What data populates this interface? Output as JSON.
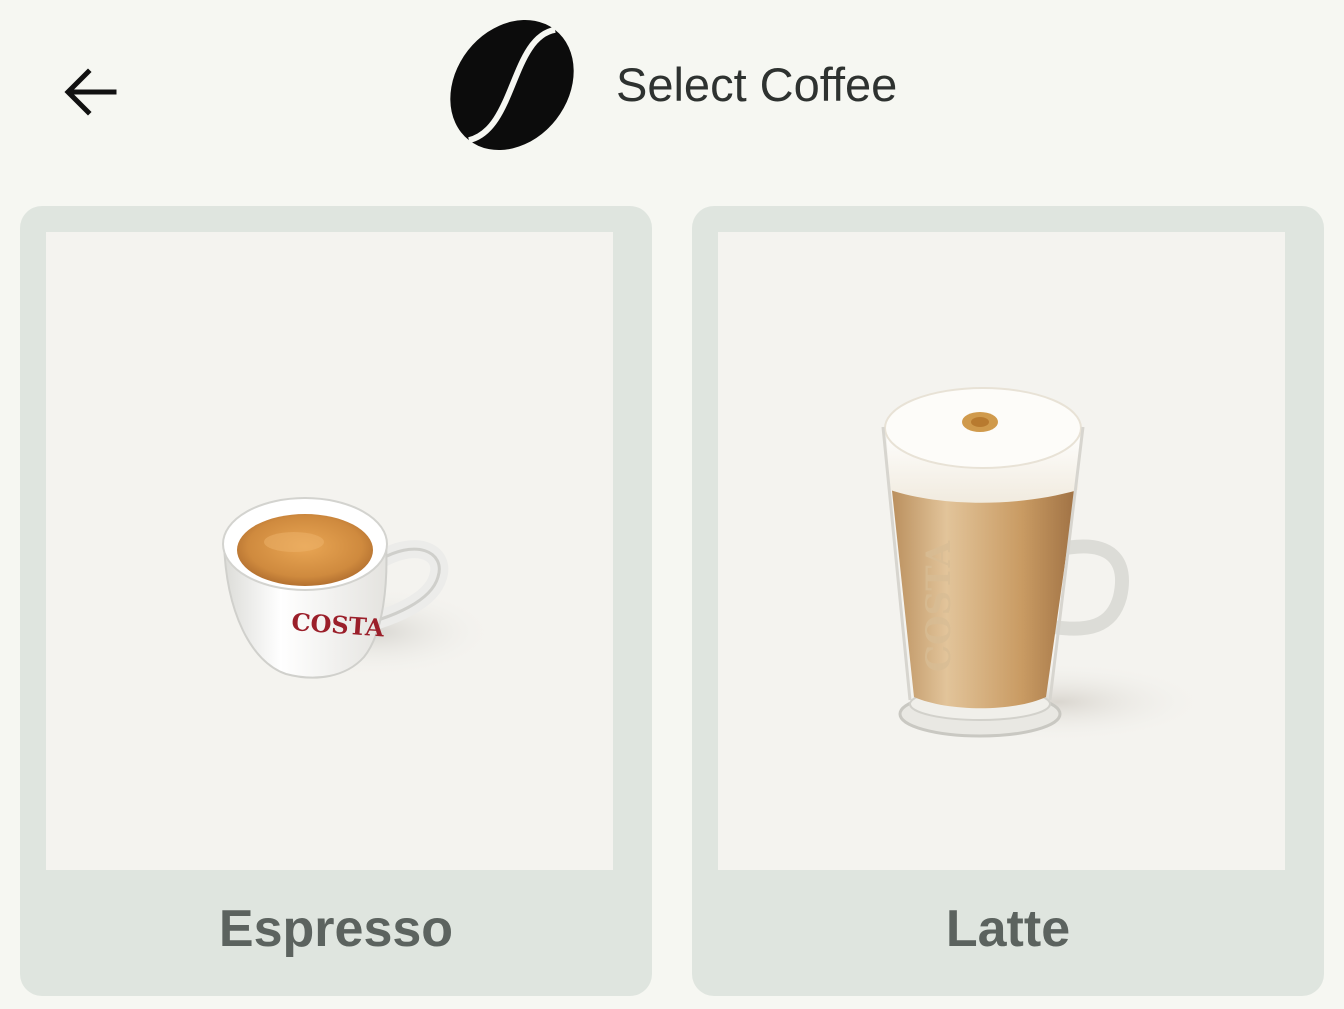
{
  "header": {
    "back_icon": "arrow-left-icon",
    "logo_icon": "coffee-bean-icon",
    "title": "Select Coffee"
  },
  "coffees": [
    {
      "name": "Espresso",
      "image": "espresso-cup",
      "cup_text": "COSTA",
      "cup_text_color": "#9b1f2a"
    },
    {
      "name": "Latte",
      "image": "latte-glass",
      "glass_text": "COSTA"
    }
  ],
  "colors": {
    "background": "#f6f7f2",
    "card": "#dfe5df",
    "photo_bg": "#f4f3ef",
    "label": "#5c635f",
    "title": "#2e3230"
  }
}
